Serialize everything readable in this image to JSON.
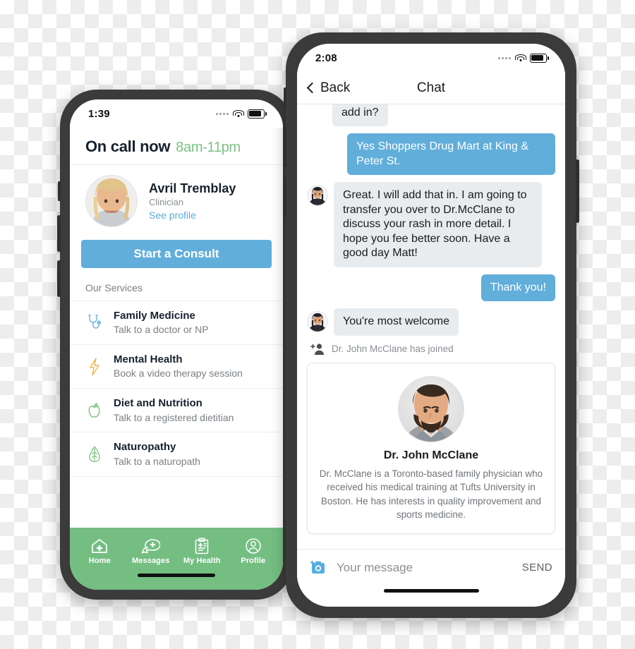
{
  "left_phone": {
    "status_bar": {
      "time": "1:39",
      "signal_icon": "signal-dots-icon",
      "wifi_icon": "wifi-icon",
      "battery_icon": "battery-icon"
    },
    "on_call": {
      "title": "On call now",
      "hours": "8am-11pm",
      "hours_color": "#7dc184"
    },
    "clinician": {
      "name": "Avril Tremblay",
      "role": "Clinician",
      "profile_link": "See profile",
      "avatar": "clinician-avatar"
    },
    "consult_button": {
      "label": "Start a Consult",
      "color": "#61aedb"
    },
    "services_heading": "Our Services",
    "services": [
      {
        "icon": "stethoscope-icon",
        "icon_color": "#6bb2dd",
        "title": "Family Medicine",
        "subtitle": "Talk to a doctor or NP"
      },
      {
        "icon": "lightning-bolt-icon",
        "icon_color": "#f0b44a",
        "title": "Mental Health",
        "subtitle": "Book a video therapy session"
      },
      {
        "icon": "apple-icon",
        "icon_color": "#7dc184",
        "title": "Diet and Nutrition",
        "subtitle": "Talk to a registered dietitian"
      },
      {
        "icon": "leaf-icon",
        "icon_color": "#7dc184",
        "title": "Naturopathy",
        "subtitle": "Talk to a naturopath"
      }
    ],
    "tab_bar": {
      "color": "#74be82",
      "tabs": [
        {
          "icon": "home-plus-icon",
          "label": "Home",
          "active": true
        },
        {
          "icon": "messages-icon",
          "label": "Messages",
          "active": false
        },
        {
          "icon": "clipboard-health-icon",
          "label": "My Health",
          "active": false
        },
        {
          "icon": "profile-icon",
          "label": "Profile",
          "active": false
        }
      ]
    }
  },
  "right_phone": {
    "status_bar": {
      "time": "2:08",
      "signal_icon": "signal-dots-icon",
      "wifi_icon": "wifi-icon",
      "battery_icon": "battery-icon"
    },
    "nav": {
      "back_label": "Back",
      "back_icon": "chevron-left-icon",
      "title": "Chat"
    },
    "messages": [
      {
        "from": "them",
        "text": "add in?",
        "clipped": true,
        "avatar": false
      },
      {
        "from": "me",
        "text": "Yes Shoppers Drug Mart at King & Peter St.",
        "avatar": false
      },
      {
        "from": "them",
        "text": "Great. I will add that in. I am going to transfer you over to Dr.McClane to discuss your rash in more detail. I hope you fee better soon. Have a good day Matt!",
        "avatar": true
      },
      {
        "from": "me",
        "text": "Thank you!",
        "avatar": false
      },
      {
        "from": "them",
        "text": "You're most welcome",
        "avatar": true
      }
    ],
    "system_event": {
      "icon": "add-person-icon",
      "text": "Dr. John McClane has joined"
    },
    "doctor_card": {
      "avatar": "doctor-avatar",
      "name": "Dr. John McClane",
      "bio": "Dr. McClane is a Toronto-based family physician who received his medical training at Tufts University in Boston. He has interests in quality improvement and sports medicine."
    },
    "composer": {
      "camera_icon": "camera-add-icon",
      "camera_color": "#57ace0",
      "input_value": "",
      "input_placeholder": "Your message",
      "send_label": "SEND"
    }
  },
  "theme": {
    "blue": "#61aedb",
    "green": "#74be82",
    "bubble_grey": "#e9ecee",
    "frame": "#3b3b3b"
  }
}
